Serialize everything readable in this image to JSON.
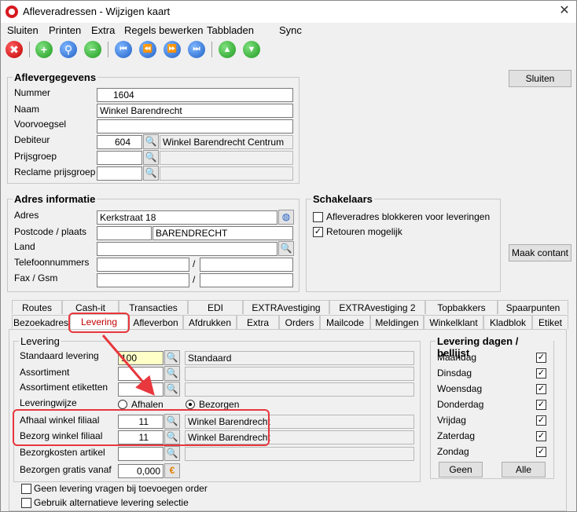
{
  "window": {
    "title": "Afleveradressen - Wijzigen kaart"
  },
  "menu": [
    "Sluiten",
    "Printen",
    "Extra",
    "Regels bewerken",
    "Tabbladen",
    "Sync"
  ],
  "toolbar_icons": [
    "close-red-icon",
    "add-icon",
    "search-icon",
    "remove-icon",
    "first-icon",
    "prev-icon",
    "next-icon",
    "last-icon",
    "up-icon",
    "down-icon"
  ],
  "toolbar_glyphs": {
    "close": "✖",
    "add": "+",
    "search": "⚲",
    "remove": "−",
    "first": "⏮",
    "prev": "⏪",
    "next": "⏩",
    "last": "⏭",
    "up": "▲",
    "down": "▼"
  },
  "aflever": {
    "title": "Aflevergegevens",
    "nummer_label": "Nummer",
    "nummer": "1604",
    "naam_label": "Naam",
    "naam": "Winkel Barendrecht",
    "voorvoegsel_label": "Voorvoegsel",
    "voorvoegsel": "",
    "debiteur_label": "Debiteur",
    "debiteur": "604",
    "debiteur_naam": "Winkel Barendrecht Centrum",
    "prijsgroep_label": "Prijsgroep",
    "reclame_label": "Reclame prijsgroep"
  },
  "adres": {
    "title": "Adres informatie",
    "adres_label": "Adres",
    "adres": "Kerkstraat 18",
    "postcode_label": "Postcode / plaats",
    "plaats": "BARENDRECHT",
    "land_label": "Land",
    "telefoon_label": "Telefoonnummers",
    "fax_label": "Fax / Gsm",
    "slash": "/"
  },
  "schakelaars": {
    "title": "Schakelaars",
    "blokkeren": "Afleveradres blokkeren voor leveringen",
    "retouren": "Retouren mogelijk"
  },
  "buttons": {
    "sluiten": "Sluiten",
    "maak_contant": "Maak contant"
  },
  "tabs_row1": [
    "Routes",
    "Cash-it",
    "Transacties",
    "EDI",
    "EXTRAvestiging",
    "EXTRAvestiging 2",
    "Topbakkers",
    "Spaarpunten"
  ],
  "tabs_row2": [
    "Bezoekadres",
    "Levering",
    "Afleverbon",
    "Afdrukken",
    "Extra",
    "Orders",
    "Mailcode",
    "Meldingen",
    "Winkelklant",
    "Kladblok",
    "Etiket"
  ],
  "levering": {
    "title": "Levering",
    "standaard_label": "Standaard levering",
    "standaard_code": "100",
    "standaard_naam": "Standaard",
    "assortiment_label": "Assortiment",
    "assortiment_etiketten_label": "Assortiment etiketten",
    "leveringwijze_label": "Leveringwijze",
    "afhalen": "Afhalen",
    "bezorgen": "Bezorgen",
    "afhaal_label": "Afhaal winkel filiaal",
    "afhaal_nr": "11",
    "afhaal_naam": "Winkel Barendrecht",
    "bezorg_label": "Bezorg winkel filiaal",
    "bezorg_nr": "11",
    "bezorg_naam": "Winkel Barendrecht",
    "bezorgkosten_label": "Bezorgkosten artikel",
    "gratis_label": "Bezorgen gratis vanaf",
    "gratis": "0,000",
    "euro": "€",
    "geen_vragen": "Geen levering vragen bij toevoegen order",
    "alternatief": "Gebruik alternatieve levering selectie"
  },
  "dagen": {
    "title": "Levering dagen / bellijst",
    "days": [
      "Maandag",
      "Dinsdag",
      "Woensdag",
      "Donderdag",
      "Vrijdag",
      "Zaterdag",
      "Zondag"
    ],
    "geen": "Geen",
    "alle": "Alle"
  },
  "glyphs": {
    "check": "✓",
    "lookup": "🔍",
    "globe": "◍",
    "close": "✕"
  },
  "colors": {
    "highlight": "#e8373d",
    "yellow_field": "#ffffc8"
  }
}
